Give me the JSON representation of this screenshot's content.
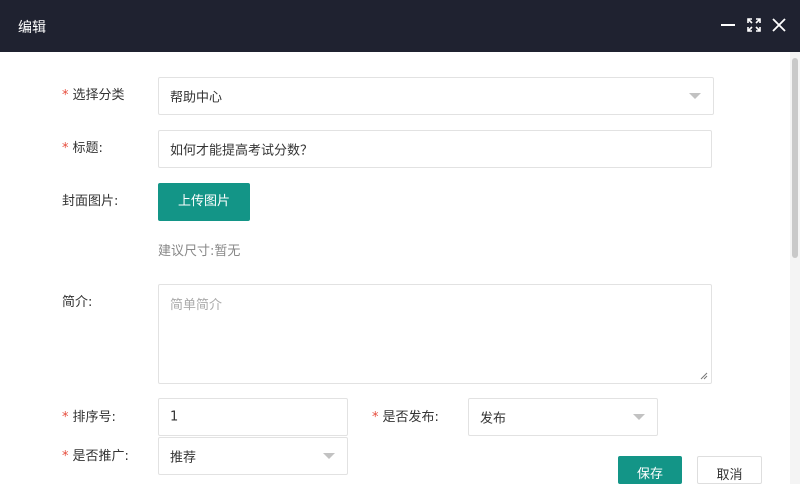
{
  "window": {
    "title": "编辑",
    "controls": {
      "minimize_icon": "minimize-icon",
      "maximize_icon": "maximize-icon",
      "close_icon": "close-icon"
    }
  },
  "form": {
    "category": {
      "label": "选择分类",
      "required": true,
      "value": "帮助中心"
    },
    "title": {
      "label": "标题:",
      "required": true,
      "value": "如何才能提高考试分数？"
    },
    "cover": {
      "label": "封面图片:",
      "upload_button": "上传图片",
      "hint": "建议尺寸:暂无"
    },
    "intro": {
      "label": "简介:",
      "placeholder": "简单简介"
    },
    "sort": {
      "label": "排序号:",
      "required": true,
      "value": "1"
    },
    "publish": {
      "label": "是否发布:",
      "required": true,
      "value": "发布"
    },
    "promote": {
      "label": "是否推广:",
      "required": true,
      "value": "推荐"
    }
  },
  "footer": {
    "save_label": "保存",
    "cancel_label": "取消"
  },
  "colors": {
    "titlebar": "#1f2230",
    "primary": "#139587",
    "required": "#e64b3b"
  }
}
